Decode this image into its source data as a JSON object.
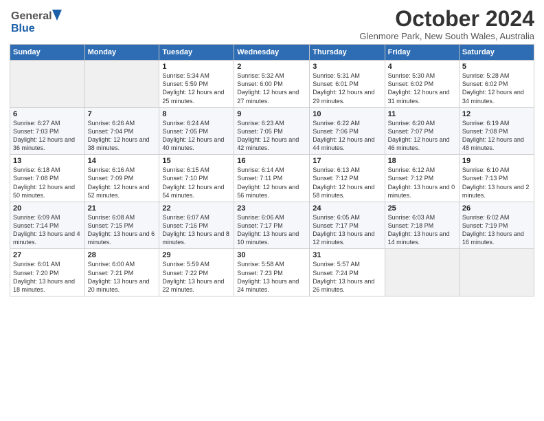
{
  "logo": {
    "line1": "General",
    "line2": "Blue"
  },
  "title": "October 2024",
  "subtitle": "Glenmore Park, New South Wales, Australia",
  "days_of_week": [
    "Sunday",
    "Monday",
    "Tuesday",
    "Wednesday",
    "Thursday",
    "Friday",
    "Saturday"
  ],
  "weeks": [
    [
      {
        "num": "",
        "sunrise": "",
        "sunset": "",
        "daylight": ""
      },
      {
        "num": "",
        "sunrise": "",
        "sunset": "",
        "daylight": ""
      },
      {
        "num": "1",
        "sunrise": "Sunrise: 5:34 AM",
        "sunset": "Sunset: 5:59 PM",
        "daylight": "Daylight: 12 hours and 25 minutes."
      },
      {
        "num": "2",
        "sunrise": "Sunrise: 5:32 AM",
        "sunset": "Sunset: 6:00 PM",
        "daylight": "Daylight: 12 hours and 27 minutes."
      },
      {
        "num": "3",
        "sunrise": "Sunrise: 5:31 AM",
        "sunset": "Sunset: 6:01 PM",
        "daylight": "Daylight: 12 hours and 29 minutes."
      },
      {
        "num": "4",
        "sunrise": "Sunrise: 5:30 AM",
        "sunset": "Sunset: 6:02 PM",
        "daylight": "Daylight: 12 hours and 31 minutes."
      },
      {
        "num": "5",
        "sunrise": "Sunrise: 5:28 AM",
        "sunset": "Sunset: 6:02 PM",
        "daylight": "Daylight: 12 hours and 34 minutes."
      }
    ],
    [
      {
        "num": "6",
        "sunrise": "Sunrise: 6:27 AM",
        "sunset": "Sunset: 7:03 PM",
        "daylight": "Daylight: 12 hours and 36 minutes."
      },
      {
        "num": "7",
        "sunrise": "Sunrise: 6:26 AM",
        "sunset": "Sunset: 7:04 PM",
        "daylight": "Daylight: 12 hours and 38 minutes."
      },
      {
        "num": "8",
        "sunrise": "Sunrise: 6:24 AM",
        "sunset": "Sunset: 7:05 PM",
        "daylight": "Daylight: 12 hours and 40 minutes."
      },
      {
        "num": "9",
        "sunrise": "Sunrise: 6:23 AM",
        "sunset": "Sunset: 7:05 PM",
        "daylight": "Daylight: 12 hours and 42 minutes."
      },
      {
        "num": "10",
        "sunrise": "Sunrise: 6:22 AM",
        "sunset": "Sunset: 7:06 PM",
        "daylight": "Daylight: 12 hours and 44 minutes."
      },
      {
        "num": "11",
        "sunrise": "Sunrise: 6:20 AM",
        "sunset": "Sunset: 7:07 PM",
        "daylight": "Daylight: 12 hours and 46 minutes."
      },
      {
        "num": "12",
        "sunrise": "Sunrise: 6:19 AM",
        "sunset": "Sunset: 7:08 PM",
        "daylight": "Daylight: 12 hours and 48 minutes."
      }
    ],
    [
      {
        "num": "13",
        "sunrise": "Sunrise: 6:18 AM",
        "sunset": "Sunset: 7:08 PM",
        "daylight": "Daylight: 12 hours and 50 minutes."
      },
      {
        "num": "14",
        "sunrise": "Sunrise: 6:16 AM",
        "sunset": "Sunset: 7:09 PM",
        "daylight": "Daylight: 12 hours and 52 minutes."
      },
      {
        "num": "15",
        "sunrise": "Sunrise: 6:15 AM",
        "sunset": "Sunset: 7:10 PM",
        "daylight": "Daylight: 12 hours and 54 minutes."
      },
      {
        "num": "16",
        "sunrise": "Sunrise: 6:14 AM",
        "sunset": "Sunset: 7:11 PM",
        "daylight": "Daylight: 12 hours and 56 minutes."
      },
      {
        "num": "17",
        "sunrise": "Sunrise: 6:13 AM",
        "sunset": "Sunset: 7:12 PM",
        "daylight": "Daylight: 12 hours and 58 minutes."
      },
      {
        "num": "18",
        "sunrise": "Sunrise: 6:12 AM",
        "sunset": "Sunset: 7:12 PM",
        "daylight": "Daylight: 13 hours and 0 minutes."
      },
      {
        "num": "19",
        "sunrise": "Sunrise: 6:10 AM",
        "sunset": "Sunset: 7:13 PM",
        "daylight": "Daylight: 13 hours and 2 minutes."
      }
    ],
    [
      {
        "num": "20",
        "sunrise": "Sunrise: 6:09 AM",
        "sunset": "Sunset: 7:14 PM",
        "daylight": "Daylight: 13 hours and 4 minutes."
      },
      {
        "num": "21",
        "sunrise": "Sunrise: 6:08 AM",
        "sunset": "Sunset: 7:15 PM",
        "daylight": "Daylight: 13 hours and 6 minutes."
      },
      {
        "num": "22",
        "sunrise": "Sunrise: 6:07 AM",
        "sunset": "Sunset: 7:16 PM",
        "daylight": "Daylight: 13 hours and 8 minutes."
      },
      {
        "num": "23",
        "sunrise": "Sunrise: 6:06 AM",
        "sunset": "Sunset: 7:17 PM",
        "daylight": "Daylight: 13 hours and 10 minutes."
      },
      {
        "num": "24",
        "sunrise": "Sunrise: 6:05 AM",
        "sunset": "Sunset: 7:17 PM",
        "daylight": "Daylight: 13 hours and 12 minutes."
      },
      {
        "num": "25",
        "sunrise": "Sunrise: 6:03 AM",
        "sunset": "Sunset: 7:18 PM",
        "daylight": "Daylight: 13 hours and 14 minutes."
      },
      {
        "num": "26",
        "sunrise": "Sunrise: 6:02 AM",
        "sunset": "Sunset: 7:19 PM",
        "daylight": "Daylight: 13 hours and 16 minutes."
      }
    ],
    [
      {
        "num": "27",
        "sunrise": "Sunrise: 6:01 AM",
        "sunset": "Sunset: 7:20 PM",
        "daylight": "Daylight: 13 hours and 18 minutes."
      },
      {
        "num": "28",
        "sunrise": "Sunrise: 6:00 AM",
        "sunset": "Sunset: 7:21 PM",
        "daylight": "Daylight: 13 hours and 20 minutes."
      },
      {
        "num": "29",
        "sunrise": "Sunrise: 5:59 AM",
        "sunset": "Sunset: 7:22 PM",
        "daylight": "Daylight: 13 hours and 22 minutes."
      },
      {
        "num": "30",
        "sunrise": "Sunrise: 5:58 AM",
        "sunset": "Sunset: 7:23 PM",
        "daylight": "Daylight: 13 hours and 24 minutes."
      },
      {
        "num": "31",
        "sunrise": "Sunrise: 5:57 AM",
        "sunset": "Sunset: 7:24 PM",
        "daylight": "Daylight: 13 hours and 26 minutes."
      },
      {
        "num": "",
        "sunrise": "",
        "sunset": "",
        "daylight": ""
      },
      {
        "num": "",
        "sunrise": "",
        "sunset": "",
        "daylight": ""
      }
    ]
  ]
}
